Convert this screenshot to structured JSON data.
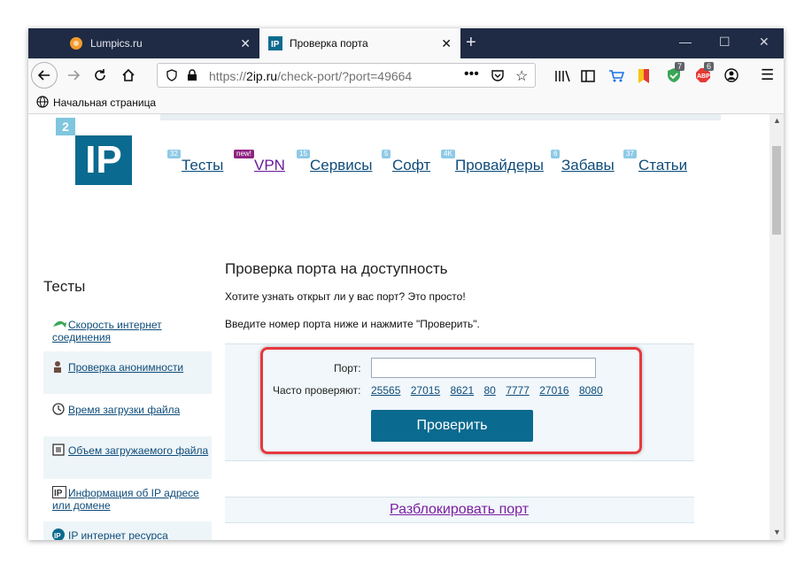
{
  "tabs": [
    {
      "title": "Lumpics.ru",
      "favicon": "lumpics-favicon-icon",
      "active": false
    },
    {
      "title": "Проверка порта",
      "favicon": "2ip-favicon-icon",
      "active": true
    }
  ],
  "url": {
    "prefix": "https://",
    "domain": "2ip.ru",
    "path": "/check-port/?port=49664"
  },
  "bookmarks": {
    "home_label": "Начальная страница"
  },
  "toolbar": {
    "badge_ublock": "7",
    "badge_abp": "6"
  },
  "site": {
    "logo_small": "2",
    "logo_big": "IP",
    "menu": [
      {
        "label": "Тесты",
        "badge": "32"
      },
      {
        "label": "VPN",
        "badge": "new!"
      },
      {
        "label": "Сервисы",
        "badge": "15"
      },
      {
        "label": "Софт",
        "badge": "5"
      },
      {
        "label": "Провайдеры",
        "badge": "4K"
      },
      {
        "label": "Забавы",
        "badge": "6"
      },
      {
        "label": "Статьи",
        "badge": "37"
      }
    ]
  },
  "sidebar": {
    "title": "Тесты",
    "items": [
      {
        "label": "Скорость интернет соединения"
      },
      {
        "label": "Проверка анонимности"
      },
      {
        "label": "Время загрузки файла"
      },
      {
        "label": "Объем загружаемого файла"
      },
      {
        "label": "Информация об IP адресе или домене"
      },
      {
        "label": "IP интернет ресурса"
      }
    ]
  },
  "main": {
    "heading": "Проверка порта на доступность",
    "intro": "Хотите узнать открыт ли у вас порт? Это просто!",
    "instruction": "Введите номер порта ниже и нажмите \"Проверить\".",
    "port_label": "Порт:",
    "port_value": "",
    "often_label": "Часто проверяют:",
    "ports": [
      "25565",
      "27015",
      "8621",
      "80",
      "7777",
      "27016",
      "8080"
    ],
    "check_button": "Проверить",
    "unblock_link": "Разблокировать порт"
  }
}
